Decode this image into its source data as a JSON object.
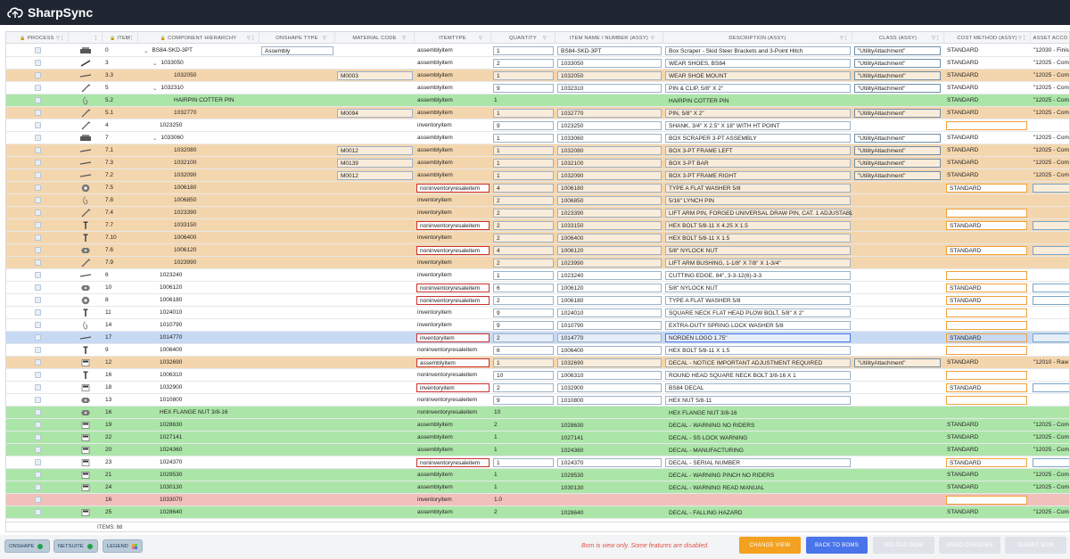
{
  "app": {
    "title": "SharpSync"
  },
  "columns": [
    {
      "label": "PROCESS",
      "lock": true,
      "filter": true,
      "menu": true
    },
    {
      "label": "",
      "menu": true
    },
    {
      "label": "ITEM",
      "lock": true,
      "filter": true,
      "menu": true
    },
    {
      "label": "COMPONENT HIERARCHY",
      "lock": true,
      "filter": true,
      "menu": true
    },
    {
      "label": "ONSHAPE TYPE",
      "filter": true
    },
    {
      "label": "MATERIAL CODE",
      "filter": true
    },
    {
      "label": "ITEMTYPE",
      "filter": true
    },
    {
      "label": "QUANTITY",
      "filter": true
    },
    {
      "label": "ITEM NAME / NUMBER (ASSY)",
      "filter": true
    },
    {
      "label": "DESCRIPTION (ASSY)",
      "filter": true,
      "menu": true
    },
    {
      "label": "CLASS (ASSY)",
      "filter": true,
      "menu": true
    },
    {
      "label": "COST METHOD (ASSY)",
      "filter": true,
      "menu": true
    },
    {
      "label": "ASSET ACCO",
      "filter": false
    }
  ],
  "rows": [
    {
      "color": "white",
      "icon": "assembly",
      "item": "0",
      "caret": true,
      "indent": 0,
      "hier": "BS84-SKD-3PT",
      "onshape": "Assembly",
      "mat": "",
      "itype": "assemblyitem",
      "ityperb": false,
      "qty": "1",
      "qbox": true,
      "name": "BS84-SKD-3PT",
      "desc": "Box Scraper - Skid Steer Brackets and 3-Point Hitch",
      "cls": "\"UtilityAttachment\"",
      "cost": "STANDARD",
      "costb": false,
      "asset": "\"12030 - Finis"
    },
    {
      "color": "white",
      "icon": "shoe",
      "item": "3",
      "caret": true,
      "indent": 1,
      "hier": "1033050",
      "onshape": "",
      "mat": "",
      "itype": "assemblyitem",
      "ityperb": false,
      "qty": "2",
      "qbox": true,
      "name": "1033050",
      "desc": "WEAR SHOES, BS84",
      "cls": "\"UtilityAttachment\"",
      "cost": "STANDARD",
      "costb": false,
      "asset": "\"12025 - Com"
    },
    {
      "color": "orange",
      "icon": "bar",
      "item": "3.3",
      "caret": false,
      "indent": 2,
      "hier": "1032050",
      "onshape": "",
      "mat": "M0003",
      "itype": "assemblyitem",
      "ityperb": false,
      "qty": "1",
      "qbox": true,
      "name": "1032050",
      "desc": "WEAR SHOE MOUNT",
      "cls": "\"UtilityAttachment\"",
      "cost": "STANDARD",
      "costb": false,
      "asset": "\"12025 - Com"
    },
    {
      "color": "white",
      "icon": "pin",
      "item": "5",
      "caret": true,
      "indent": 1,
      "hier": "1032310",
      "onshape": "",
      "mat": "",
      "itype": "assemblyitem",
      "ityperb": false,
      "qty": "9",
      "qbox": true,
      "name": "1032310",
      "desc": "PIN & CLIP, 5/8\" X 2\"",
      "cls": "\"UtilityAttachment\"",
      "cost": "STANDARD",
      "costb": false,
      "asset": "\"12025 - Com"
    },
    {
      "color": "green",
      "icon": "clip",
      "item": "5.2",
      "caret": false,
      "indent": 2,
      "hier": "HAIRPIN COTTER PIN",
      "onshape": "",
      "mat": "",
      "itype": "assemblyitem",
      "ityperb": false,
      "qty": "1",
      "qbox": false,
      "name": "",
      "desc": "HAIRPIN COTTER PIN",
      "cls": "",
      "cost": "STANDARD",
      "costb": false,
      "asset": "\"12025 - Com"
    },
    {
      "color": "orange",
      "icon": "pin",
      "item": "5.1",
      "caret": false,
      "indent": 2,
      "hier": "1032770",
      "onshape": "",
      "mat": "M0094",
      "itype": "assemblyitem",
      "ityperb": false,
      "qty": "1",
      "qbox": true,
      "name": "1032770",
      "desc": "PIN, 5/8\" X 2\"",
      "cls": "\"UtilityAttachment\"",
      "cost": "STANDARD",
      "costb": false,
      "asset": "\"12025 - Com"
    },
    {
      "color": "white",
      "icon": "pin",
      "item": "4",
      "caret": false,
      "indent": 1,
      "hier": "1023250",
      "onshape": "",
      "mat": "",
      "itype": "inventoryitem",
      "ityperb": false,
      "qty": "9",
      "qbox": true,
      "name": "1023250",
      "desc": "SHANK, 3/4\" X 2.5\" X 18\" WITH HT POINT",
      "cls": "",
      "cost": "",
      "costb": true,
      "asset": ""
    },
    {
      "color": "white",
      "icon": "assembly",
      "item": "7",
      "caret": true,
      "indent": 1,
      "hier": "1033060",
      "onshape": "",
      "mat": "",
      "itype": "assemblyitem",
      "ityperb": false,
      "qty": "1",
      "qbox": true,
      "name": "1033060",
      "desc": "BOX SCRAPER 3-PT ASSEMBLY",
      "cls": "\"UtilityAttachment\"",
      "cost": "STANDARD",
      "costb": false,
      "asset": "\"12025 - Com"
    },
    {
      "color": "orange",
      "icon": "bar",
      "item": "7.1",
      "caret": false,
      "indent": 2,
      "hier": "1032080",
      "onshape": "",
      "mat": "M0012",
      "itype": "assemblyitem",
      "ityperb": false,
      "qty": "1",
      "qbox": true,
      "name": "1032080",
      "desc": "BOX 3-PT FRAME LEFT",
      "cls": "\"UtilityAttachment\"",
      "cost": "STANDARD",
      "costb": false,
      "asset": "\"12025 - Com"
    },
    {
      "color": "orange",
      "icon": "bar",
      "item": "7.3",
      "caret": false,
      "indent": 2,
      "hier": "1032100",
      "onshape": "",
      "mat": "M0139",
      "itype": "assemblyitem",
      "ityperb": false,
      "qty": "1",
      "qbox": true,
      "name": "1032100",
      "desc": "BOX 3-PT BAR",
      "cls": "\"UtilityAttachment\"",
      "cost": "STANDARD",
      "costb": false,
      "asset": "\"12025 - Com"
    },
    {
      "color": "orange",
      "icon": "bar",
      "item": "7.2",
      "caret": false,
      "indent": 2,
      "hier": "1032090",
      "onshape": "",
      "mat": "M0012",
      "itype": "assemblyitem",
      "ityperb": false,
      "qty": "1",
      "qbox": true,
      "name": "1032090",
      "desc": "BOX 3-PT FRAME RIGHT",
      "cls": "\"UtilityAttachment\"",
      "cost": "STANDARD",
      "costb": false,
      "asset": "\"12025 - Com"
    },
    {
      "color": "orange",
      "icon": "washer",
      "item": "7.5",
      "caret": false,
      "indent": 2,
      "hier": "1006180",
      "onshape": "",
      "mat": "",
      "itype": "noninventoryresaleitem",
      "ityperb": true,
      "qty": "4",
      "qbox": true,
      "name": "1006180",
      "desc": "TYPE A FLAT WASHER 5/8",
      "cls": "",
      "cost": "STANDARD",
      "costb": true,
      "asset": ""
    },
    {
      "color": "orange",
      "icon": "clip",
      "item": "7.8",
      "caret": false,
      "indent": 2,
      "hier": "1006850",
      "onshape": "",
      "mat": "",
      "itype": "inventoryitem",
      "ityperb": false,
      "qty": "2",
      "qbox": true,
      "name": "1006850",
      "desc": "5/16\" LYNCH PIN",
      "cls": "",
      "cost": "",
      "costb": false,
      "asset": ""
    },
    {
      "color": "orange",
      "icon": "pin",
      "item": "7.4",
      "caret": false,
      "indent": 2,
      "hier": "1023390",
      "onshape": "",
      "mat": "",
      "itype": "inventoryitem",
      "ityperb": false,
      "qty": "2",
      "qbox": true,
      "name": "1023390",
      "desc": "LIFT ARM PIN, FORGED UNIVERSAL DRAW PIN, CAT. 1 ADJUSTABLE",
      "cls": "",
      "cost": "",
      "costb": true,
      "asset": ""
    },
    {
      "color": "orange",
      "icon": "bolt",
      "item": "7.7",
      "caret": false,
      "indent": 2,
      "hier": "1033150",
      "onshape": "",
      "mat": "",
      "itype": "noninventoryresaleitem",
      "ityperb": true,
      "qty": "2",
      "qbox": true,
      "name": "1033150",
      "desc": "HEX BOLT 5/8-11 X 4.25 X 1.5",
      "cls": "",
      "cost": "STANDARD",
      "costb": true,
      "asset": ""
    },
    {
      "color": "orange",
      "icon": "bolt",
      "item": "7.10",
      "caret": false,
      "indent": 2,
      "hier": "1006400",
      "onshape": "",
      "mat": "",
      "itype": "inventoryitem",
      "ityperb": false,
      "qty": "2",
      "qbox": true,
      "name": "1006400",
      "desc": "HEX BOLT 5/8-11 X 1.5",
      "cls": "",
      "cost": "",
      "costb": false,
      "asset": ""
    },
    {
      "color": "orange",
      "icon": "nut",
      "item": "7.6",
      "caret": false,
      "indent": 2,
      "hier": "1006120",
      "onshape": "",
      "mat": "",
      "itype": "noninventoryresaleitem",
      "ityperb": true,
      "qty": "4",
      "qbox": true,
      "name": "1006120",
      "desc": "5/8\" NYLOCK NUT",
      "cls": "",
      "cost": "STANDARD",
      "costb": true,
      "asset": ""
    },
    {
      "color": "orange",
      "icon": "pin",
      "item": "7.9",
      "caret": false,
      "indent": 2,
      "hier": "1023990",
      "onshape": "",
      "mat": "",
      "itype": "inventoryitem",
      "ityperb": false,
      "qty": "2",
      "qbox": true,
      "name": "1023990",
      "desc": "LIFT ARM BUSHING, 1-1/8\" X 7/8\" X 1-3/4\"",
      "cls": "",
      "cost": "",
      "costb": false,
      "asset": ""
    },
    {
      "color": "white",
      "icon": "bar",
      "item": "6",
      "caret": false,
      "indent": 1,
      "hier": "1023240",
      "onshape": "",
      "mat": "",
      "itype": "inventoryitem",
      "ityperb": false,
      "qty": "1",
      "qbox": true,
      "name": "1023240",
      "desc": "CUTTING EDGE, 84\", 3-3-12(6)-3-3",
      "cls": "",
      "cost": "",
      "costb": true,
      "asset": ""
    },
    {
      "color": "white",
      "icon": "nut",
      "item": "10",
      "caret": false,
      "indent": 1,
      "hier": "1006120",
      "onshape": "",
      "mat": "",
      "itype": "noninventoryresaleitem",
      "ityperb": true,
      "qty": "6",
      "qbox": true,
      "name": "1006120",
      "desc": "5/8\" NYLOCK NUT",
      "cls": "",
      "cost": "STANDARD",
      "costb": true,
      "asset": ""
    },
    {
      "color": "white",
      "icon": "washer",
      "item": "8",
      "caret": false,
      "indent": 1,
      "hier": "1006180",
      "onshape": "",
      "mat": "",
      "itype": "noninventoryresaleitem",
      "ityperb": true,
      "qty": "2",
      "qbox": true,
      "name": "1006180",
      "desc": "TYPE A FLAT WASHER 5/8",
      "cls": "",
      "cost": "STANDARD",
      "costb": true,
      "asset": ""
    },
    {
      "color": "white",
      "icon": "bolt",
      "item": "11",
      "caret": false,
      "indent": 1,
      "hier": "1024010",
      "onshape": "",
      "mat": "",
      "itype": "inventoryitem",
      "ityperb": false,
      "qty": "9",
      "qbox": true,
      "name": "1024010",
      "desc": "SQUARE NECK FLAT HEAD PLOW BOLT, 5/8\" X 2\"",
      "cls": "",
      "cost": "",
      "costb": true,
      "asset": ""
    },
    {
      "color": "white",
      "icon": "clip",
      "item": "14",
      "caret": false,
      "indent": 1,
      "hier": "1010790",
      "onshape": "",
      "mat": "",
      "itype": "inventoryitem",
      "ityperb": false,
      "qty": "9",
      "qbox": true,
      "name": "1010790",
      "desc": "EXTRA-DUTY SPRING LOCK WASHER 5/8",
      "cls": "",
      "cost": "",
      "costb": true,
      "asset": ""
    },
    {
      "color": "selected",
      "icon": "bar",
      "item": "17",
      "caret": false,
      "indent": 1,
      "hier": "1014770",
      "onshape": "",
      "mat": "",
      "itype": "inventoryitem",
      "ityperb": true,
      "qty": "2",
      "qbox": true,
      "name": "1014770",
      "desc": "NORDEN LOGO 1.75\"",
      "cls": "",
      "cost": "STANDARD",
      "costb": true,
      "asset": ""
    },
    {
      "color": "white",
      "icon": "bolt",
      "item": "9",
      "caret": false,
      "indent": 1,
      "hier": "1006400",
      "onshape": "",
      "mat": "",
      "itype": "noninventoryresaleitem",
      "ityperb": false,
      "qty": "6",
      "qbox": true,
      "name": "1006400",
      "desc": "HEX BOLT 5/8-11 X 1.5",
      "cls": "",
      "cost": "",
      "costb": true,
      "asset": ""
    },
    {
      "color": "orange",
      "icon": "decal",
      "item": "12",
      "caret": false,
      "indent": 1,
      "hier": "1032690",
      "onshape": "",
      "mat": "",
      "itype": "assemblyitem",
      "ityperb": true,
      "qty": "1",
      "qbox": true,
      "name": "1032690",
      "desc": "DECAL - NOTICE IMPORTANT ADJUSTMENT REQUIRED",
      "cls": "\"UtilityAttachment\"",
      "cost": "STANDARD",
      "costb": false,
      "asset": "\"12010 - Raw"
    },
    {
      "color": "white",
      "icon": "bolt",
      "item": "16",
      "caret": false,
      "indent": 1,
      "hier": "1006310",
      "onshape": "",
      "mat": "",
      "itype": "noninventoryresaleitem",
      "ityperb": false,
      "qty": "10",
      "qbox": true,
      "name": "1006310",
      "desc": "ROUND HEAD SQUARE NECK BOLT 3/8-16 X 1",
      "cls": "",
      "cost": "",
      "costb": true,
      "asset": ""
    },
    {
      "color": "white",
      "icon": "decal",
      "item": "18",
      "caret": false,
      "indent": 1,
      "hier": "1032900",
      "onshape": "",
      "mat": "",
      "itype": "inventoryitem",
      "ityperb": true,
      "qty": "2",
      "qbox": true,
      "name": "1032900",
      "desc": "BS84 DECAL",
      "cls": "",
      "cost": "STANDARD",
      "costb": true,
      "asset": ""
    },
    {
      "color": "white",
      "icon": "nut",
      "item": "13",
      "caret": false,
      "indent": 1,
      "hier": "1010800",
      "onshape": "",
      "mat": "",
      "itype": "noninventoryresaleitem",
      "ityperb": false,
      "qty": "9",
      "qbox": true,
      "name": "1010800",
      "desc": "HEX NUT 5/8-11",
      "cls": "",
      "cost": "",
      "costb": true,
      "asset": ""
    },
    {
      "color": "green",
      "icon": "nut",
      "item": "16",
      "caret": false,
      "indent": 1,
      "hier": "HEX FLANGE NUT 3/8-16",
      "onshape": "",
      "mat": "",
      "itype": "noninventoryresaleitem",
      "ityperb": false,
      "qty": "10",
      "qbox": false,
      "name": "",
      "desc": "HEX FLANGE NUT 3/8-16",
      "cls": "",
      "cost": "",
      "costb": false,
      "asset": ""
    },
    {
      "color": "green",
      "icon": "decal",
      "item": "19",
      "caret": false,
      "indent": 1,
      "hier": "1028630",
      "onshape": "",
      "mat": "",
      "itype": "assemblyitem",
      "ityperb": false,
      "qty": "2",
      "qbox": false,
      "name": "1028630",
      "desc": "DECAL - WARNING NO RIDERS",
      "cls": "",
      "cost": "STANDARD",
      "costb": false,
      "asset": "\"12025 - Com"
    },
    {
      "color": "green",
      "icon": "decal",
      "item": "22",
      "caret": false,
      "indent": 1,
      "hier": "1027141",
      "onshape": "",
      "mat": "",
      "itype": "assemblyitem",
      "ityperb": false,
      "qty": "1",
      "qbox": false,
      "name": "1027141",
      "desc": "DECAL - SS LOCK WARNING",
      "cls": "",
      "cost": "STANDARD",
      "costb": false,
      "asset": "\"12025 - Com"
    },
    {
      "color": "green",
      "icon": "decal",
      "item": "20",
      "caret": false,
      "indent": 1,
      "hier": "1024360",
      "onshape": "",
      "mat": "",
      "itype": "assemblyitem",
      "ityperb": false,
      "qty": "1",
      "qbox": false,
      "name": "1024360",
      "desc": "DECAL - MANUFACTURING",
      "cls": "",
      "cost": "STANDARD",
      "costb": false,
      "asset": "\"12025 - Com"
    },
    {
      "color": "white",
      "icon": "decal",
      "item": "23",
      "caret": false,
      "indent": 1,
      "hier": "1024370",
      "onshape": "",
      "mat": "",
      "itype": "noninventoryresaleitem",
      "ityperb": true,
      "qty": "1",
      "qbox": true,
      "name": "1024370",
      "desc": "DECAL - SERIAL NUMBER",
      "cls": "",
      "cost": "STANDARD",
      "costb": true,
      "asset": ""
    },
    {
      "color": "green",
      "icon": "decal",
      "item": "21",
      "caret": false,
      "indent": 1,
      "hier": "1029530",
      "onshape": "",
      "mat": "",
      "itype": "assemblyitem",
      "ityperb": false,
      "qty": "1",
      "qbox": false,
      "name": "1029530",
      "desc": "DECAL - WARNING PINCH NO RIDERS",
      "cls": "",
      "cost": "STANDARD",
      "costb": false,
      "asset": "\"12025 - Com"
    },
    {
      "color": "green",
      "icon": "decal",
      "item": "24",
      "caret": false,
      "indent": 1,
      "hier": "1030130",
      "onshape": "",
      "mat": "",
      "itype": "assemblyitem",
      "ityperb": false,
      "qty": "1",
      "qbox": false,
      "name": "1030130",
      "desc": "DECAL - WARNING READ MANUAL",
      "cls": "",
      "cost": "STANDARD",
      "costb": false,
      "asset": "\"12025 - Com"
    },
    {
      "color": "red",
      "icon": "none",
      "item": "16",
      "caret": false,
      "indent": 1,
      "hier": "1033070",
      "onshape": "",
      "mat": "",
      "itype": "inventoryitem",
      "ityperb": false,
      "qty": "1.0",
      "qbox": false,
      "name": "",
      "desc": "",
      "cls": "",
      "cost": "",
      "costb": true,
      "asset": ""
    },
    {
      "color": "green",
      "icon": "decal",
      "item": "25",
      "caret": false,
      "indent": 1,
      "hier": "1028640",
      "onshape": "",
      "mat": "",
      "itype": "assemblyitem",
      "ityperb": false,
      "qty": "2",
      "qbox": false,
      "name": "1028640",
      "desc": "DECAL - FALLING HAZARD",
      "cls": "",
      "cost": "STANDARD",
      "costb": false,
      "asset": "\"12025 - Com"
    }
  ],
  "footer": {
    "items_count": "ITEMS: 68"
  },
  "bottombar": {
    "onshape": "ONSHAPE",
    "netsuite": "NETSUITE",
    "legend": "LEGEND",
    "warning": "Bom is view only. Some features are disabled.",
    "change_view": "CHANGE VIEW",
    "back_to_boms": "BACK TO BOMS",
    "reload_bom": "RELOAD BOM",
    "undo_changes": "UNDO CHANGES",
    "submit_bom": "SUBMIT BOM"
  }
}
